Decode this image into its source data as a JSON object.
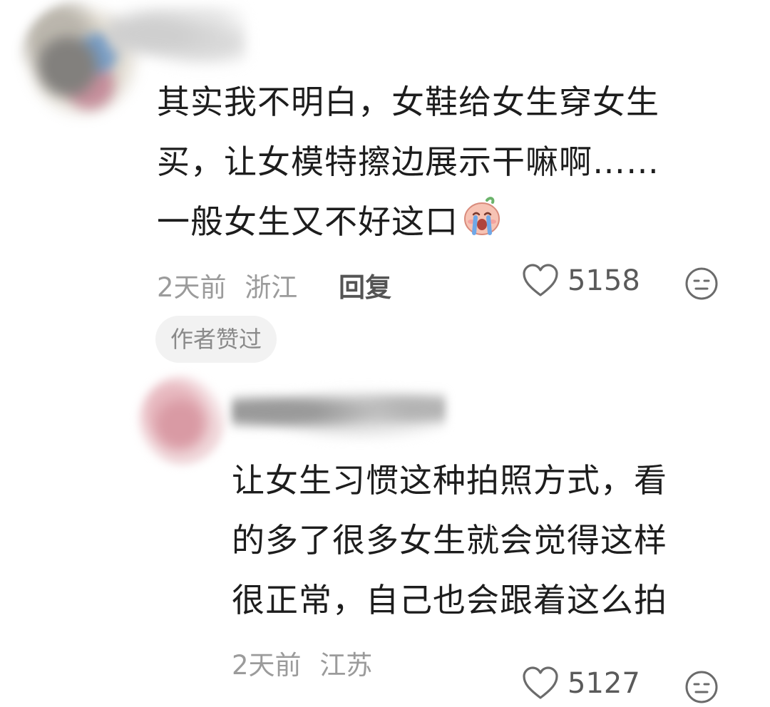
{
  "main_comment": {
    "lines": [
      "其实我不明白，女鞋给女生穿女生",
      "买，让女模特擦边展示干嘛啊……",
      "一般女生又不好这口"
    ],
    "emoji": "crying-face",
    "time": "2天前",
    "location": "浙江",
    "reply_label": "回复",
    "like_count": "5158",
    "author_liked_badge": "作者赞过"
  },
  "reply_comment": {
    "lines": [
      "让女生习惯这种拍照方式，看",
      "的多了很多女生就会觉得这样",
      "很正常，自己也会跟着这么拍"
    ],
    "time": "2天前",
    "location": "江苏",
    "like_count": "5127"
  },
  "colors": {
    "text": "#1d1d1d",
    "meta": "#9b9b9b",
    "icon": "#6b6b6b",
    "badge_bg": "#f2f2f2"
  }
}
